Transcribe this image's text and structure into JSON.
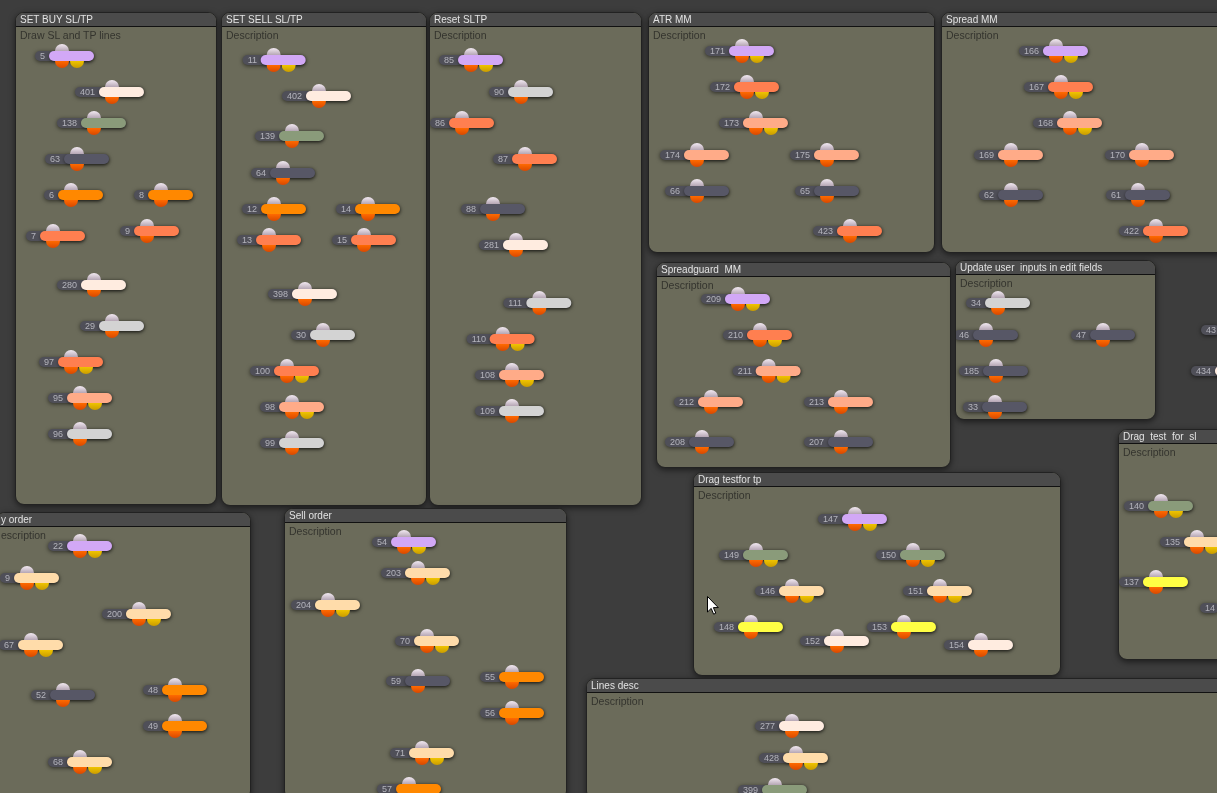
{
  "groups": [
    {
      "title": "SET BUY SL/TP",
      "description": "Draw SL and TP lines",
      "nodes": [
        {
          "label": "5",
          "color": "#d2a8f6",
          "kind": "dual"
        },
        {
          "label": "401",
          "color": "#ffece0",
          "kind": "single"
        },
        {
          "label": "138",
          "color": "#8a9b7a",
          "kind": "single"
        },
        {
          "label": "63",
          "color": "#575766",
          "kind": "single"
        },
        {
          "label": "6",
          "color": "#ff8800",
          "kind": "single"
        },
        {
          "label": "8",
          "color": "#ff8800",
          "kind": "single"
        },
        {
          "label": "7",
          "color": "#ff7f50",
          "kind": "single"
        },
        {
          "label": "9",
          "color": "#ff7f50",
          "kind": "single"
        },
        {
          "label": "280",
          "color": "#ffece0",
          "kind": "single"
        },
        {
          "label": "29",
          "color": "#d3d3d3",
          "kind": "single"
        },
        {
          "label": "97",
          "color": "#ff7f50",
          "kind": "dual"
        },
        {
          "label": "95",
          "color": "#ffab88",
          "kind": "dual"
        },
        {
          "label": "96",
          "color": "#d3d3d3",
          "kind": "single"
        }
      ]
    },
    {
      "title": "SET SELL SL/TP",
      "description": "Description",
      "nodes": [
        {
          "label": "11",
          "color": "#d2a8f6",
          "kind": "dual"
        },
        {
          "label": "402",
          "color": "#ffece0",
          "kind": "single"
        },
        {
          "label": "139",
          "color": "#8a9b7a",
          "kind": "single"
        },
        {
          "label": "64",
          "color": "#575766",
          "kind": "single"
        },
        {
          "label": "12",
          "color": "#ff8800",
          "kind": "single"
        },
        {
          "label": "14",
          "color": "#ff8800",
          "kind": "single"
        },
        {
          "label": "13",
          "color": "#ff7f50",
          "kind": "single"
        },
        {
          "label": "15",
          "color": "#ff7f50",
          "kind": "single"
        },
        {
          "label": "398",
          "color": "#ffece0",
          "kind": "single"
        },
        {
          "label": "30",
          "color": "#d3d3d3",
          "kind": "single"
        },
        {
          "label": "100",
          "color": "#ff7f50",
          "kind": "dual"
        },
        {
          "label": "98",
          "color": "#ffab88",
          "kind": "dual"
        },
        {
          "label": "99",
          "color": "#d3d3d3",
          "kind": "single"
        }
      ]
    },
    {
      "title": "Reset SLTP",
      "description": "Description",
      "nodes": [
        {
          "label": "85",
          "color": "#d2a8f6",
          "kind": "dual"
        },
        {
          "label": "90",
          "color": "#d3d3d3",
          "kind": "single"
        },
        {
          "label": "86",
          "color": "#ff7f50",
          "kind": "single"
        },
        {
          "label": "87",
          "color": "#ff7f50",
          "kind": "single"
        },
        {
          "label": "88",
          "color": "#575766",
          "kind": "single"
        },
        {
          "label": "281",
          "color": "#ffece0",
          "kind": "single"
        },
        {
          "label": "111",
          "color": "#d3d3d3",
          "kind": "single"
        },
        {
          "label": "110",
          "color": "#ff7f50",
          "kind": "dual"
        },
        {
          "label": "108",
          "color": "#ffab88",
          "kind": "dual"
        },
        {
          "label": "109",
          "color": "#d3d3d3",
          "kind": "single"
        }
      ]
    },
    {
      "title": "ATR MM",
      "description": "Description",
      "nodes": [
        {
          "label": "171",
          "color": "#d2a8f6",
          "kind": "dual"
        },
        {
          "label": "172",
          "color": "#ff7f50",
          "kind": "dual"
        },
        {
          "label": "173",
          "color": "#ffab88",
          "kind": "dual"
        },
        {
          "label": "174",
          "color": "#ffab88",
          "kind": "single"
        },
        {
          "label": "175",
          "color": "#ffab88",
          "kind": "single"
        },
        {
          "label": "66",
          "color": "#575766",
          "kind": "single"
        },
        {
          "label": "65",
          "color": "#575766",
          "kind": "single"
        },
        {
          "label": "423",
          "color": "#ff7f50",
          "kind": "single"
        }
      ]
    },
    {
      "title": "Spread MM",
      "description": "Description",
      "nodes": [
        {
          "label": "166",
          "color": "#d2a8f6",
          "kind": "dual"
        },
        {
          "label": "167",
          "color": "#ff7f50",
          "kind": "dual"
        },
        {
          "label": "168",
          "color": "#ffab88",
          "kind": "dual"
        },
        {
          "label": "169",
          "color": "#ffab88",
          "kind": "single"
        },
        {
          "label": "170",
          "color": "#ffab88",
          "kind": "single"
        },
        {
          "label": "62",
          "color": "#575766",
          "kind": "single"
        },
        {
          "label": "61",
          "color": "#575766",
          "kind": "single"
        },
        {
          "label": "422",
          "color": "#ff7f50",
          "kind": "single"
        }
      ]
    },
    {
      "title": "Spreadguard  MM",
      "description": "Description",
      "nodes": [
        {
          "label": "209",
          "color": "#d2a8f6",
          "kind": "dual"
        },
        {
          "label": "210",
          "color": "#ff7f50",
          "kind": "dual"
        },
        {
          "label": "211",
          "color": "#ffab88",
          "kind": "dual"
        },
        {
          "label": "212",
          "color": "#ffab88",
          "kind": "single"
        },
        {
          "label": "213",
          "color": "#ffab88",
          "kind": "single"
        },
        {
          "label": "208",
          "color": "#575766",
          "kind": "single"
        },
        {
          "label": "207",
          "color": "#575766",
          "kind": "single"
        }
      ]
    },
    {
      "title": "Update user  inputs in edit fields",
      "description": "Description",
      "nodes": [
        {
          "label": "34",
          "color": "#d3d3d3",
          "kind": "single"
        },
        {
          "label": "46",
          "color": "#575766",
          "kind": "single"
        },
        {
          "label": "47",
          "color": "#575766",
          "kind": "single"
        },
        {
          "label": "185",
          "color": "#575766",
          "kind": "single"
        },
        {
          "label": "33",
          "color": "#575766",
          "kind": "single"
        }
      ]
    },
    {
      "title": "Drag  test  for  sl",
      "description": "Description",
      "nodes": [
        {
          "label": "140",
          "color": "#8a9b7a",
          "kind": "dual"
        },
        {
          "label": "135",
          "color": "#ffdcaa",
          "kind": "dual"
        },
        {
          "label": "137",
          "color": "#ffff44",
          "kind": "single"
        },
        {
          "label": "14"
        }
      ]
    },
    {
      "title": "y order",
      "description": "escription",
      "nodes": [
        {
          "label": "22",
          "color": "#d2a8f6",
          "kind": "dual"
        },
        {
          "label": "9",
          "color": "#ffdcaa",
          "kind": "dual"
        },
        {
          "label": "200",
          "color": "#ffdcaa",
          "kind": "dual"
        },
        {
          "label": "67",
          "color": "#ffdcaa",
          "kind": "dual"
        },
        {
          "label": "52",
          "color": "#575766",
          "kind": "single"
        },
        {
          "label": "48",
          "color": "#ff8800",
          "kind": "single"
        },
        {
          "label": "49",
          "color": "#ff8800",
          "kind": "single"
        },
        {
          "label": "68",
          "color": "#ffdcaa",
          "kind": "dual"
        }
      ]
    },
    {
      "title": "Sell order",
      "description": "Description",
      "nodes": [
        {
          "label": "54",
          "color": "#d2a8f6",
          "kind": "dual"
        },
        {
          "label": "203",
          "color": "#ffdcaa",
          "kind": "dual"
        },
        {
          "label": "204",
          "color": "#ffdcaa",
          "kind": "dual"
        },
        {
          "label": "70",
          "color": "#ffdcaa",
          "kind": "dual"
        },
        {
          "label": "59",
          "color": "#575766",
          "kind": "single"
        },
        {
          "label": "55",
          "color": "#ff8800",
          "kind": "single"
        },
        {
          "label": "56",
          "color": "#ff8800",
          "kind": "single"
        },
        {
          "label": "71",
          "color": "#ffdcaa",
          "kind": "dual"
        },
        {
          "label": "57",
          "color": "#ff8800",
          "kind": "single"
        }
      ]
    },
    {
      "title": "Drag testfor tp",
      "description": "Description",
      "nodes": [
        {
          "label": "147",
          "color": "#d2a8f6",
          "kind": "dual"
        },
        {
          "label": "149",
          "color": "#8a9b7a",
          "kind": "dual"
        },
        {
          "label": "150",
          "color": "#8a9b7a",
          "kind": "dual"
        },
        {
          "label": "146",
          "color": "#ffdcaa",
          "kind": "dual"
        },
        {
          "label": "151",
          "color": "#ffdcaa",
          "kind": "dual"
        },
        {
          "label": "148",
          "color": "#ffff44",
          "kind": "single"
        },
        {
          "label": "152",
          "color": "#ffece0",
          "kind": "single"
        },
        {
          "label": "153",
          "color": "#ffff44",
          "kind": "single"
        },
        {
          "label": "154",
          "color": "#ffece0",
          "kind": "single"
        }
      ]
    },
    {
      "title": "Lines desc",
      "description": "Description",
      "nodes": [
        {
          "label": "277",
          "color": "#ffece0",
          "kind": "single"
        },
        {
          "label": "428",
          "color": "#ffdcaa",
          "kind": "dual"
        },
        {
          "label": "399",
          "color": "#8a9b7a",
          "kind": "single"
        }
      ]
    }
  ],
  "loose_nodes": [
    {
      "label": "43"
    },
    {
      "label": "434",
      "color": "#ffece0"
    }
  ]
}
